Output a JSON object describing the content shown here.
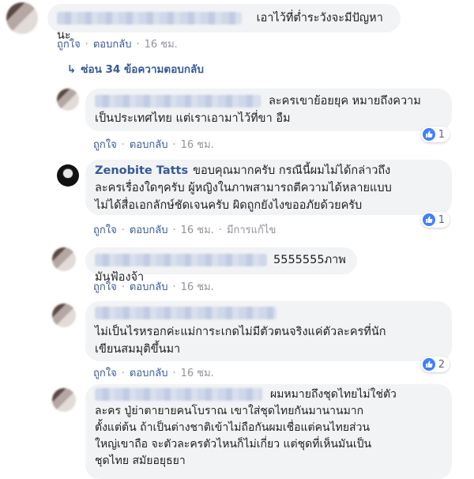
{
  "actions": {
    "like": "ถูกใจ",
    "reply": "ตอบกลับ",
    "dot": "·",
    "edited": "มีการแก้ไข"
  },
  "top_comment": {
    "text": "เอาไว้ที่ต่ำระวังจะมีปัญหานะ",
    "time": "16 ชม."
  },
  "hide_replies": {
    "icon": "↳",
    "label": "ซ่อน 34 ข้อความตอบกลับ"
  },
  "replies": [
    {
      "text_line1": "ละครเขาย้อยยุค หมายถึงความ",
      "text_line2": "เป็นประเทศไทย แต่เราเอามาไว้ที่ขา อืม",
      "time": "16 ชม.",
      "like_count": "1"
    },
    {
      "name": "Zenobite Tatts",
      "text_line1": "ขอบคุณมากครับ กรณีนี้ผมไม่ได้กล่าวถึง",
      "text_line2": "ละครเรื่องใดๆครับ ผู้หญิงในภาพสามารถตีความได้หลายแบบ",
      "text_line3": "ไม่ได้สื่อเอกลักษ์ชัดเจนครับ ผิดถูกยังไงขออภัยด้วยครับ",
      "time": "16 ชม.",
      "like_count": "1"
    },
    {
      "text": "5555555ภาพมันฟ้องจ้า",
      "time": "16 ชม."
    },
    {
      "text_line1": "ไม่เป็นไรหรอกค่ะแม่การะเกดไม่มีตัวตนจริงแค่ตัวละครที่นัก",
      "text_line2": "เขียนสมมุติขึ้นมา",
      "time": "16 ชม.",
      "like_count": "2"
    },
    {
      "text_line1": "ผมหมายถึงชุดไทยไม่ใช่ตัว",
      "text_line2": "ละคร ปู่ย่าตายายคนโบราณ เขาใส่ชุดไทยกันมานานมาก",
      "text_line3": "ตั้งแต่ต้น ถ้าเป็นต่างชาติเข้าไม่ถือกันผมเชื่อแต่คนไทยส่วน",
      "text_line4": "ใหญ่เขาถือ จะตัวละครตัวไหนก็ไม่เกี่ยว แต่ชุดที่เห็นมันเป็น",
      "text_line5": "ชุดไทย สมัยอยุธยา"
    }
  ]
}
